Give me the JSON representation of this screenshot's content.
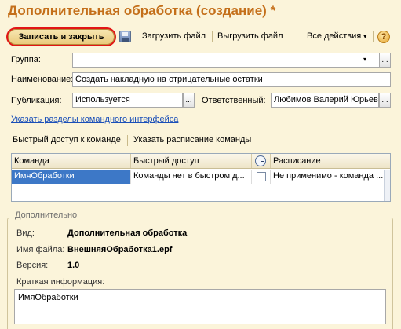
{
  "window": {
    "title": "Дополнительная обработка (создание) *"
  },
  "toolbar": {
    "save_close_label": "Записать и закрыть",
    "save_icon": "floppy-disk-icon",
    "upload_label": "Загрузить файл",
    "download_label": "Выгрузить файл",
    "all_actions_label": "Все действия",
    "all_actions_arrow": "▾",
    "help_glyph": "?"
  },
  "form": {
    "group_label": "Группа:",
    "group_value": "",
    "group_pick": "...",
    "group_dropdown": "▾",
    "name_label": "Наименование:",
    "name_value": "Создать накладную на отрицательные остатки",
    "publication_label": "Публикация:",
    "publication_value": "Используется",
    "publication_pick": "...",
    "responsible_label": "Ответственный:",
    "responsible_value": "Любимов Валерий Юрьевич",
    "responsible_pick": "..."
  },
  "links": {
    "command_sections": "Указать разделы командного интерфейса"
  },
  "commands_bar": {
    "quick_access": "Быстрый доступ к команде",
    "schedule": "Указать расписание команды"
  },
  "commands_table": {
    "columns": [
      "Команда",
      "Быстрый доступ",
      "",
      "Расписание"
    ],
    "clock_icon": "clock-icon",
    "rows": [
      {
        "command": "ИмяОбработки",
        "quick_access": "Команды нет в быстром д...",
        "scheduled": false,
        "schedule": "Не применимо - команда ..."
      }
    ]
  },
  "additional": {
    "legend": "Дополнительно",
    "kind_label": "Вид:",
    "kind_value": "Дополнительная обработка",
    "file_label": "Имя файла:",
    "file_value": "ВнешняяОбработка1.epf",
    "version_label": "Версия:",
    "version_value": "1.0",
    "brief_label": "Краткая информация:",
    "brief_value": "ИмяОбработки"
  },
  "colors": {
    "title": "#c46f1a",
    "highlight_ring": "#e21515",
    "selection": "#3d78c7",
    "link": "#1a4fb8"
  }
}
